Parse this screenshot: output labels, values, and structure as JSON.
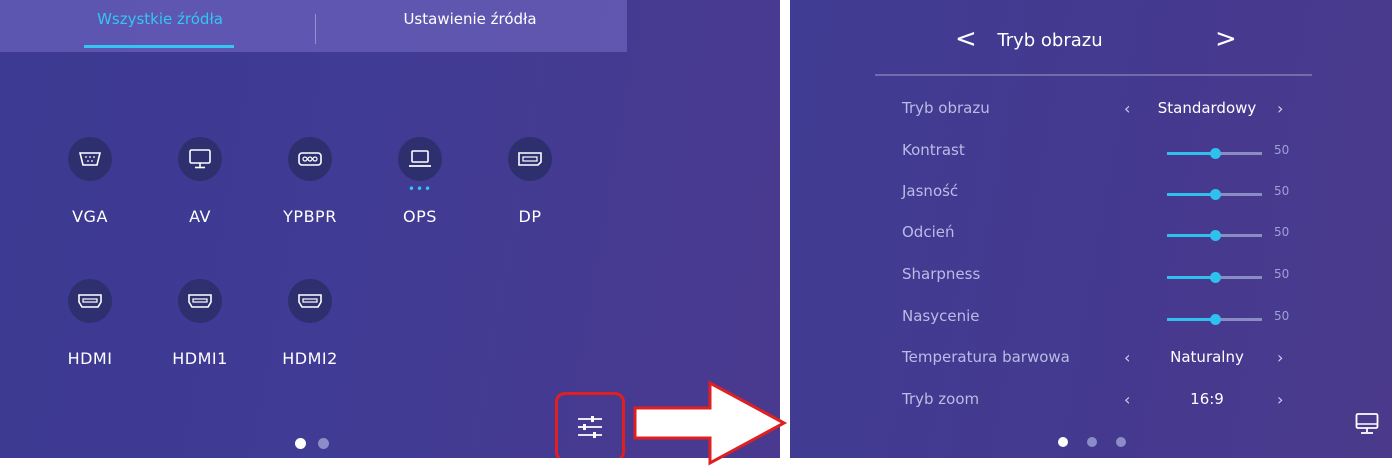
{
  "tabs": {
    "all_sources": "Wszystkie źródła",
    "source_settings": "Ustawienie źródła"
  },
  "sources": [
    {
      "label": "VGA",
      "icon": "vga-port-icon"
    },
    {
      "label": "AV",
      "icon": "monitor-icon"
    },
    {
      "label": "YPBPR",
      "icon": "ypbpr-port-icon"
    },
    {
      "label": "OPS",
      "icon": "laptop-icon",
      "indicator": "•••"
    },
    {
      "label": "DP",
      "icon": "displayport-icon"
    },
    {
      "label": "HDMI",
      "icon": "hdmi-port-icon"
    },
    {
      "label": "HDMI1",
      "icon": "hdmi-port-icon"
    },
    {
      "label": "HDMI2",
      "icon": "hdmi-port-icon"
    }
  ],
  "picture_panel": {
    "title": "Tryb obrazu",
    "rows": {
      "picture_mode": {
        "label": "Tryb obrazu",
        "value": "Standardowy"
      },
      "contrast": {
        "label": "Kontrast",
        "value": "50"
      },
      "brightness": {
        "label": "Jasność",
        "value": "50"
      },
      "hue": {
        "label": "Odcień",
        "value": "50"
      },
      "sharpness": {
        "label": "Sharpness",
        "value": "50"
      },
      "saturation": {
        "label": "Nasycenie",
        "value": "50"
      },
      "color_temp": {
        "label": "Temperatura barwowa",
        "value": "Naturalny"
      },
      "zoom": {
        "label": "Tryb zoom",
        "value": "16:9"
      }
    },
    "slider_level_fraction": 0.5,
    "prev_arrow": "<",
    "next_arrow": ">",
    "row_prev": "‹",
    "row_next": "›"
  },
  "colors": {
    "accent": "#34c6f0",
    "highlight_border": "#e02020"
  }
}
